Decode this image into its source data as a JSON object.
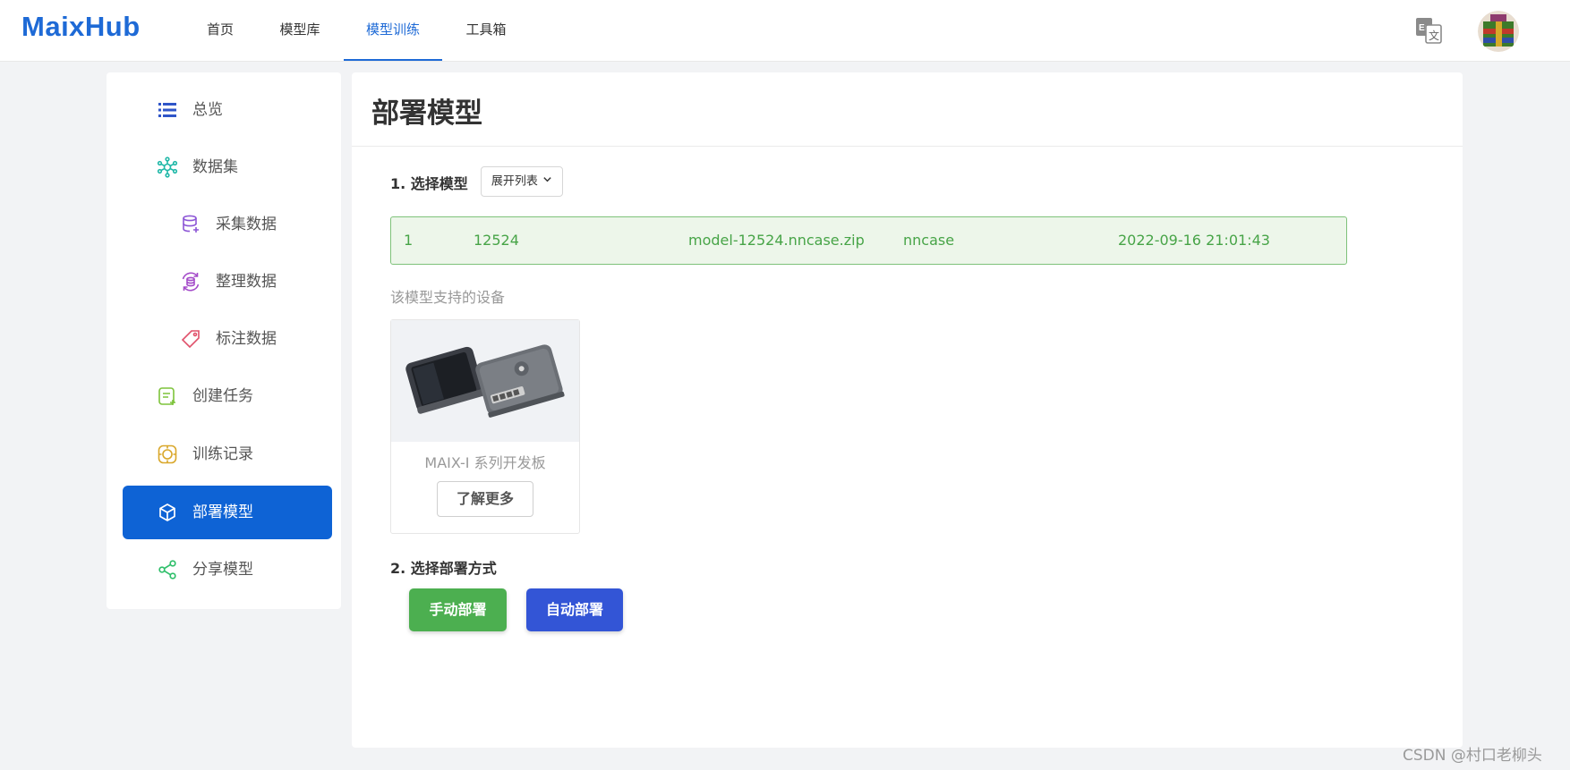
{
  "brand": {
    "logo_text": "MaixHub",
    "accent": "#1e6ad6"
  },
  "nav": {
    "items": [
      {
        "label": "首页"
      },
      {
        "label": "模型库"
      },
      {
        "label": "模型训练"
      },
      {
        "label": "工具箱"
      }
    ],
    "active": "模型训练",
    "language_icon": "translate-icon",
    "avatar_icon": "user-avatar"
  },
  "sidebar": {
    "items": [
      {
        "label": "总览",
        "icon": "list-icon"
      },
      {
        "label": "数据集",
        "icon": "dataset-icon"
      },
      {
        "label": "采集数据",
        "icon": "database-add-icon"
      },
      {
        "label": "整理数据",
        "icon": "database-refresh-icon"
      },
      {
        "label": "标注数据",
        "icon": "tag-icon"
      },
      {
        "label": "创建任务",
        "icon": "task-add-icon"
      },
      {
        "label": "训练记录",
        "icon": "record-icon"
      },
      {
        "label": "部署模型",
        "icon": "cube-icon"
      },
      {
        "label": "分享模型",
        "icon": "share-icon"
      }
    ],
    "active": "部署模型",
    "active_color": "#0e63d5"
  },
  "main": {
    "title": "部署模型",
    "step1_label": "1. 选择模型",
    "expand_label": "展开列表",
    "model_row": {
      "index": "1",
      "id": "12524",
      "file": "model-12524.nncase.zip",
      "format": "nncase",
      "time": "2022-09-16 21:01:43"
    },
    "supported_label": "该模型支持的设备",
    "device": {
      "name": "MAIX-I 系列开发板",
      "learn_more": "了解更多"
    },
    "step2_label": "2. 选择部署方式",
    "manual_deploy": "手动部署",
    "auto_deploy": "自动部署",
    "manual_color": "#4caf50",
    "auto_color": "#3355d6"
  },
  "watermark": "CSDN @村口老柳头"
}
